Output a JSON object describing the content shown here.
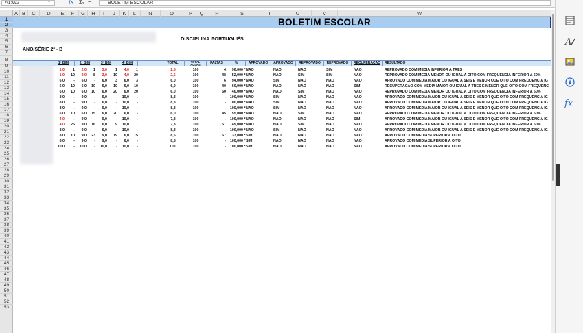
{
  "formula_bar": {
    "name_box": "A1:W2",
    "fx": "fx",
    "sigma": "Σ",
    "sigma_arrow": "▾",
    "equals": "=",
    "content": "BOLETIM ESCOLAR"
  },
  "columns": [
    "A",
    "B",
    "C",
    "D",
    "E",
    "F",
    "G",
    "H",
    "I",
    "J",
    "K",
    "L",
    "N",
    "O",
    "P",
    "Q",
    "R",
    "S",
    "T",
    "U",
    "V",
    "W"
  ],
  "rows": [
    "1",
    "2",
    "3",
    "4",
    "5",
    "6",
    "7",
    "8",
    "9",
    "10",
    "11",
    "12",
    "13",
    "14",
    "15",
    "16",
    "17",
    "18",
    "19",
    "20",
    "21",
    "22",
    "23",
    "24",
    "25",
    "26",
    "27",
    "28",
    "29",
    "30",
    "31",
    "32",
    "33",
    "34",
    "35",
    "36",
    "37",
    "38",
    "39",
    "40",
    "41",
    "42",
    "43",
    "44",
    "45",
    "46",
    "47",
    "48",
    "49",
    "50",
    "51",
    "52",
    "53"
  ],
  "sheet": {
    "title": "BOLETIM ESCOLAR",
    "disciplina": "DISCIPLINA PORTUGUÊS",
    "ano_serie": "ANO/SÉRIE 2º - B",
    "headers": {
      "b1": "1º BIM",
      "b2": "2º BIM",
      "b3": "3º BIM",
      "b4": "4º BIM",
      "total": "TOTAL",
      "total_aulas_1": "TOTAL",
      "total_aulas_2": "AULAS",
      "faltas": "FALTAS",
      "pct": "%",
      "aprovado1": "APROVADO",
      "aprovado2": "APROVADO",
      "reprovado1": "REPROVADO",
      "reprovado2": "REPROVADO",
      "recuperacao": "RECUPERACAO",
      "resultado": "RESULTADO"
    },
    "data_rows": [
      {
        "n1": "1,0",
        "f1": "1",
        "n2": "2,0",
        "f2": "1",
        "n3": "3,0",
        "f3": "1",
        "n4": "4,0",
        "f4": "1",
        "total": "2,5",
        "aulas": "100",
        "faltas": "4",
        "pct": "96,000",
        "m": "*",
        "ap1": "NAO",
        "ap2": "NAO",
        "rp1": "NAO",
        "rp2": "SIM",
        "rec": "NAO",
        "res": "REPROVADO COM MEDIA INFERIOR A TRES",
        "red": [
          true,
          false,
          true,
          false,
          true,
          false,
          true,
          false,
          true
        ]
      },
      {
        "n1": "1,0",
        "f1": "10",
        "n2": "2,0",
        "f2": "8",
        "n3": "3,0",
        "f3": "10",
        "n4": "4,0",
        "f4": "20",
        "total": "2,5",
        "aulas": "100",
        "faltas": "48",
        "pct": "52,000",
        "m": "*",
        "ap1": "NAO",
        "ap2": "NAO",
        "rp1": "SIM",
        "rp2": "SIM",
        "rec": "NAO",
        "res": "REPROVADO COM MEDIA MENOR OU IGUAL A OITO COM FREQUENCIA INFERIOR A 60%",
        "red": [
          true,
          false,
          true,
          false,
          true,
          false,
          true,
          false,
          true
        ]
      },
      {
        "n1": "6,0",
        "f1": "-",
        "n2": "6,0",
        "f2": "-",
        "n3": "6,0",
        "f3": "3",
        "n4": "6,0",
        "f4": "3",
        "total": "6,0",
        "aulas": "100",
        "faltas": "6",
        "pct": "94,000",
        "m": "*",
        "ap1": "NAO",
        "ap2": "SIM",
        "rp1": "NAO",
        "rp2": "NAO",
        "rec": "NAO",
        "res": "APROVADO COM MEDIA MAIOR OU IGUAL A SEIS E MENOR QUE OITO COM FREQUENCIA IG",
        "red": [
          false,
          false,
          false,
          false,
          false,
          false,
          false,
          false,
          false
        ]
      },
      {
        "n1": "6,0",
        "f1": "10",
        "n2": "6,0",
        "f2": "10",
        "n3": "6,0",
        "f3": "10",
        "n4": "6,0",
        "f4": "10",
        "total": "6,0",
        "aulas": "100",
        "faltas": "40",
        "pct": "60,000",
        "m": "*",
        "ap1": "NAO",
        "ap2": "NAO",
        "rp1": "NAO",
        "rp2": "NAO",
        "rec": "SIM",
        "res": "RECUPERACAO COM MEDIA MAIOR OU IGUAL A TRES E MENOR QUE OITO COM FREQUENC",
        "red": [
          false,
          false,
          false,
          false,
          false,
          false,
          false,
          false,
          false
        ]
      },
      {
        "n1": "6,0",
        "f1": "10",
        "n2": "6,0",
        "f2": "10",
        "n3": "6,0",
        "f3": "20",
        "n4": "6,0",
        "f4": "20",
        "total": "6,0",
        "aulas": "100",
        "faltas": "60",
        "pct": "40,000",
        "m": "*",
        "ap1": "NAO",
        "ap2": "NAO",
        "rp1": "SIM",
        "rp2": "NAO",
        "rec": "NAO",
        "res": "REPROVADO COM MEDIA MENOR OU IGUAL A OITO COM FREQUENCIA INFERIOR A 60%",
        "red": [
          false,
          false,
          false,
          false,
          false,
          false,
          false,
          false,
          false
        ]
      },
      {
        "n1": "8,0",
        "f1": "-",
        "n2": "9,0",
        "f2": "-",
        "n3": "6,0",
        "f3": "-",
        "n4": "10,0",
        "f4": "-",
        "total": "8,3",
        "aulas": "100",
        "faltas": "-",
        "pct": "100,000",
        "m": "*",
        "ap1": "NAO",
        "ap2": "SIM",
        "rp1": "NAO",
        "rp2": "NAO",
        "rec": "NAO",
        "res": "APROVADO COM MEDIA MAIOR OU IGUAL A SEIS E MENOR QUE OITO COM FREQUENCIA IG",
        "red": [
          false,
          false,
          false,
          false,
          false,
          false,
          false,
          false,
          false
        ]
      },
      {
        "n1": "8,0",
        "f1": "-",
        "n2": "9,0",
        "f2": "-",
        "n3": "6,0",
        "f3": "-",
        "n4": "10,0",
        "f4": "-",
        "total": "8,3",
        "aulas": "100",
        "faltas": "-",
        "pct": "100,000",
        "m": "*",
        "ap1": "NAO",
        "ap2": "SIM",
        "rp1": "NAO",
        "rp2": "NAO",
        "rec": "NAO",
        "res": "APROVADO COM MEDIA MAIOR OU IGUAL A SEIS E MENOR QUE OITO COM FREQUENCIA IG",
        "red": [
          false,
          false,
          false,
          false,
          false,
          false,
          false,
          false,
          false
        ]
      },
      {
        "n1": "8,0",
        "f1": "-",
        "n2": "9,0",
        "f2": "-",
        "n3": "6,0",
        "f3": "-",
        "n4": "10,0",
        "f4": "-",
        "total": "8,3",
        "aulas": "100",
        "faltas": "-",
        "pct": "100,000",
        "m": "*",
        "ap1": "NAO",
        "ap2": "SIM",
        "rp1": "NAO",
        "rp2": "NAO",
        "rec": "NAO",
        "res": "APROVADO COM MEDIA MAIOR OU IGUAL A SEIS E MENOR QUE OITO COM FREQUENCIA IG",
        "red": [
          false,
          false,
          false,
          false,
          false,
          false,
          false,
          false,
          false
        ]
      },
      {
        "n1": "6,0",
        "f1": "10",
        "n2": "6,0",
        "f2": "15",
        "n3": "6,0",
        "f3": "20",
        "n4": "6,0",
        "f4": "-",
        "total": "6,0",
        "aulas": "100",
        "faltas": "45",
        "pct": "55,000",
        "m": "*",
        "ap1": "NAO",
        "ap2": "NAO",
        "rp1": "SIM",
        "rp2": "NAO",
        "rec": "NAO",
        "res": "REPROVADO COM MEDIA MENOR OU IGUAL A OITO COM FREQUENCIA INFERIOR A 60%",
        "red": [
          false,
          false,
          false,
          false,
          false,
          false,
          false,
          false,
          false
        ]
      },
      {
        "n1": "4,0",
        "f1": "-",
        "n2": "9,0",
        "f2": "-",
        "n3": "6,0",
        "f3": "-",
        "n4": "10,0",
        "f4": "-",
        "total": "7,3",
        "aulas": "100",
        "faltas": "-",
        "pct": "100,000",
        "m": "*",
        "ap1": "NAO",
        "ap2": "NAO",
        "rp1": "NAO",
        "rp2": "NAO",
        "rec": "SIM",
        "res": "APROVADO COM MEDIA MAIOR OU IGUAL A SEIS E MENOR QUE OITO COM FREQUENCIA IG",
        "red": [
          true,
          false,
          false,
          false,
          false,
          false,
          false,
          false,
          false
        ]
      },
      {
        "n1": "4,0",
        "f1": "25",
        "n2": "9,0",
        "f2": "16",
        "n3": "6,0",
        "f3": "9",
        "n4": "10,0",
        "f4": "1",
        "total": "7,3",
        "aulas": "100",
        "faltas": "51",
        "pct": "49,000",
        "m": "*",
        "ap1": "NAO",
        "ap2": "NAO",
        "rp1": "SIM",
        "rp2": "NAO",
        "rec": "NAO",
        "res": "REPROVADO COM MEDIA MENOR OU IGUAL A OITO COM FREQUENCIA INFERIOR A 60%",
        "red": [
          true,
          false,
          false,
          false,
          false,
          false,
          false,
          false,
          false
        ]
      },
      {
        "n1": "8,0",
        "f1": "-",
        "n2": "9,0",
        "f2": "-",
        "n3": "6,0",
        "f3": "-",
        "n4": "10,0",
        "f4": "-",
        "total": "8,3",
        "aulas": "100",
        "faltas": "-",
        "pct": "100,000",
        "m": "*",
        "ap1": "NAO",
        "ap2": "SIM",
        "rp1": "NAO",
        "rp2": "NAO",
        "rec": "NAO",
        "res": "APROVADO COM MEDIA MAIOR OU IGUAL A SEIS E MENOR QUE OITO COM FREQUENCIA IG",
        "red": [
          false,
          false,
          false,
          false,
          false,
          false,
          false,
          false,
          false
        ]
      },
      {
        "n1": "8,0",
        "f1": "10",
        "n2": "9,0",
        "f2": "23",
        "n3": "9,0",
        "f3": "19",
        "n4": "6,0",
        "f4": "15",
        "total": "8,5",
        "aulas": "100",
        "faltas": "67",
        "pct": "33,000",
        "m": "*",
        "ap1": "SIM",
        "ap2": "NAO",
        "rp1": "NAO",
        "rp2": "NAO",
        "rec": "NAO",
        "res": "APROVADO COM MEDIA SUPERIOR A OITO",
        "red": [
          false,
          false,
          false,
          false,
          false,
          false,
          false,
          false,
          false
        ]
      },
      {
        "n1": "8,0",
        "f1": "-",
        "n2": "9,0",
        "f2": "-",
        "n3": "9,0",
        "f3": "-",
        "n4": "6,0",
        "f4": "-",
        "total": "8,5",
        "aulas": "100",
        "faltas": "-",
        "pct": "100,000",
        "m": "*",
        "ap1": "SIM",
        "ap2": "NAO",
        "rp1": "NAO",
        "rp2": "NAO",
        "rec": "NAO",
        "res": "APROVADO COM MEDIA SUPERIOR A OITO",
        "red": [
          false,
          false,
          false,
          false,
          false,
          false,
          false,
          false,
          false
        ]
      },
      {
        "n1": "10,0",
        "f1": "-",
        "n2": "10,0",
        "f2": "-",
        "n3": "10,0",
        "f3": "-",
        "n4": "10,0",
        "f4": "-",
        "total": "10,0",
        "aulas": "100",
        "faltas": "-",
        "pct": "100,000",
        "m": "*",
        "ap1": "SIM",
        "ap2": "NAO",
        "rp1": "NAO",
        "rp2": "NAO",
        "rec": "NAO",
        "res": "APROVADO COM MEDIA SUPERIOR A OITO",
        "red": [
          false,
          false,
          false,
          false,
          false,
          false,
          false,
          false,
          false
        ]
      }
    ]
  },
  "sidebar": {
    "icons": [
      "properties-icon",
      "styles-icon",
      "gallery-icon",
      "navigator-icon",
      "functions-icon"
    ],
    "functions_label": "fx"
  },
  "colors": {
    "title_band": "#a9cdf0",
    "header_band": "#d3e6f8",
    "red_value": "#d42424"
  }
}
